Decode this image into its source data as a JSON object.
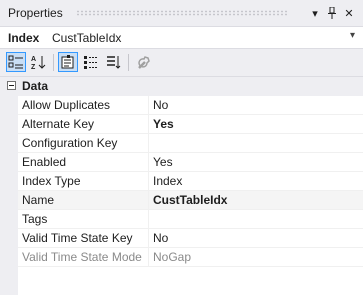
{
  "titlebar": {
    "title": "Properties",
    "dropdown_glyph": "▾",
    "pin_glyph": "⊥",
    "close_glyph": "✕"
  },
  "object": {
    "kind": "Index",
    "name": "CustTableIdx",
    "arrow": "▾"
  },
  "toolbar": {
    "icons": [
      "categorized-icon",
      "alphabetical-icon",
      "properties-icon",
      "events-icon",
      "sort-icon",
      "wrench-icon"
    ]
  },
  "grid": {
    "category": "Data",
    "rows": [
      {
        "name": "Allow Duplicates",
        "value": "No"
      },
      {
        "name": "Alternate Key",
        "value": "Yes"
      },
      {
        "name": "Configuration Key",
        "value": ""
      },
      {
        "name": "Enabled",
        "value": "Yes"
      },
      {
        "name": "Index Type",
        "value": "Index"
      },
      {
        "name": "Name",
        "value": "CustTableIdx"
      },
      {
        "name": "Tags",
        "value": ""
      },
      {
        "name": "Valid Time State Key",
        "value": "No"
      },
      {
        "name": "Valid Time State Mode",
        "value": "NoGap"
      }
    ]
  },
  "colors": {
    "chrome": "#eeeef2",
    "accent": "#3399ff",
    "disabled_text": "#8a8a8a"
  }
}
